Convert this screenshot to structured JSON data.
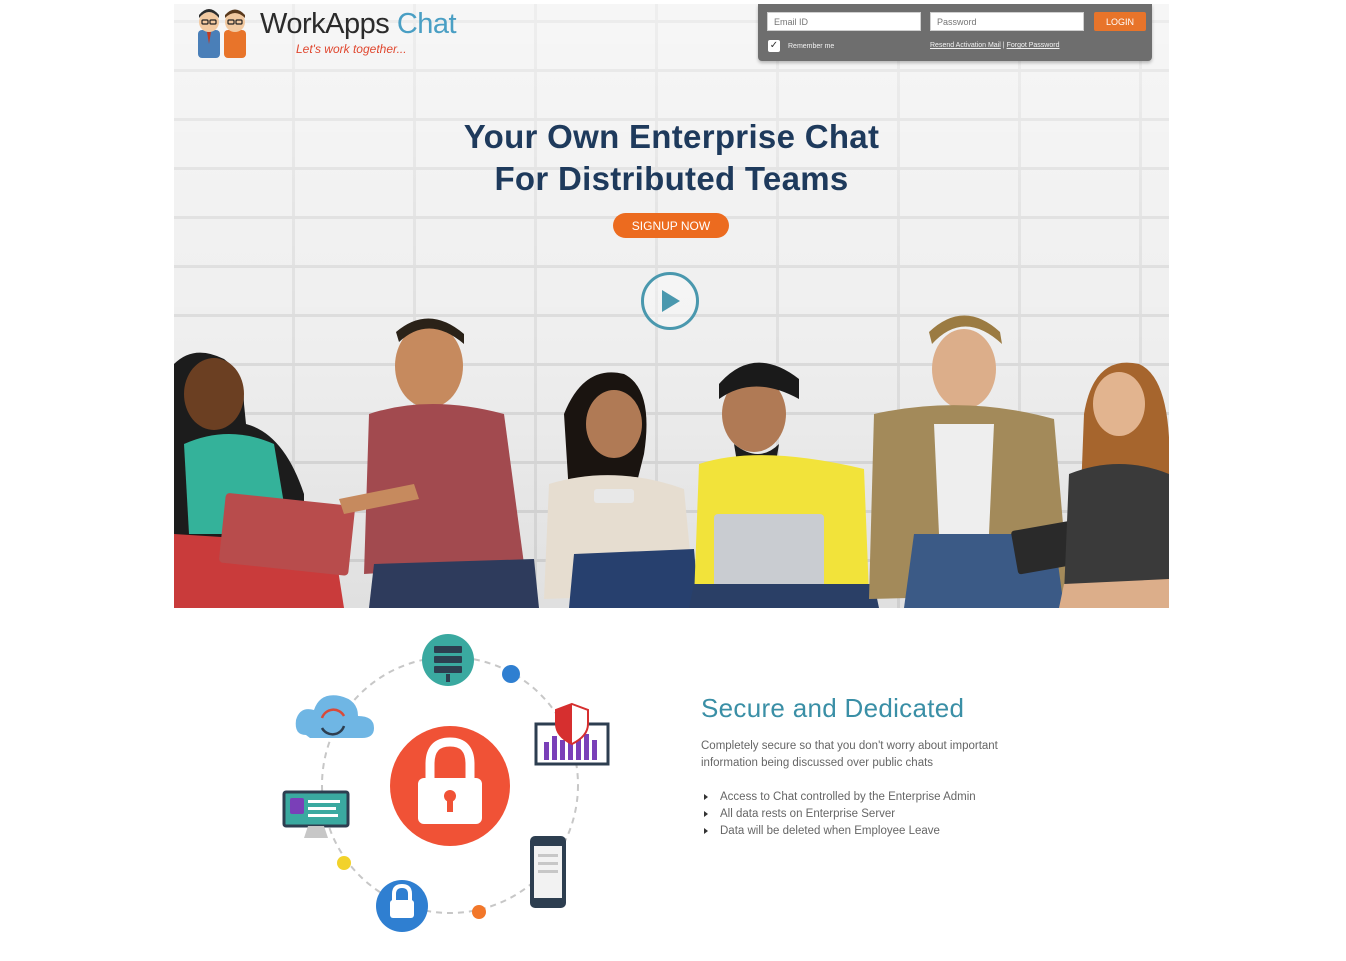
{
  "brand": {
    "name_part1": "Work",
    "name_part2": "Apps",
    "name_part3": "Chat",
    "tagline": "Let's work together..."
  },
  "login": {
    "email_placeholder": "Email ID",
    "password_placeholder": "Password",
    "button_label": "LOGIN",
    "remember_label": "Remember me",
    "remember_checked": true,
    "resend_link": "Resend Activation Mail",
    "separator": "|",
    "forgot_link": "Forgot Password"
  },
  "hero": {
    "title_line1": "Your Own Enterprise Chat",
    "title_line2": "For Distributed Teams",
    "signup_label": "SIGNUP NOW",
    "play_icon": "play-icon"
  },
  "feature": {
    "title": "Secure and Dedicated",
    "description": "Completely secure so that you don't worry about important information being discussed over public chats",
    "bullets": [
      "Access to Chat controlled by the Enterprise Admin",
      "All data rests on Enterprise Server",
      "Data will be deleted when Employee Leave"
    ],
    "icons": [
      "server-icon",
      "cloud-sync-icon",
      "shield-chart-icon",
      "padlock-icon",
      "id-card-monitor-icon",
      "smartphone-icon",
      "small-lock-icon"
    ]
  },
  "colors": {
    "accent_orange": "#ec6b1f",
    "title_navy": "#1e3a5c",
    "feature_teal": "#3a8fa6",
    "lock_red": "#f05236"
  }
}
